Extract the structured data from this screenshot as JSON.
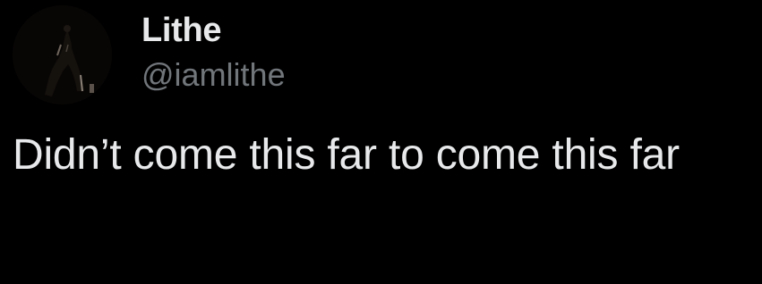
{
  "author": {
    "display_name": "Lithe",
    "handle": "@iamlithe",
    "avatar_icon": "profile-photo"
  },
  "tweet": {
    "text": "Didn’t come this far to come this far"
  },
  "colors": {
    "background": "#000000",
    "primary_text": "#e7e9ea",
    "secondary_text": "#71767b"
  }
}
